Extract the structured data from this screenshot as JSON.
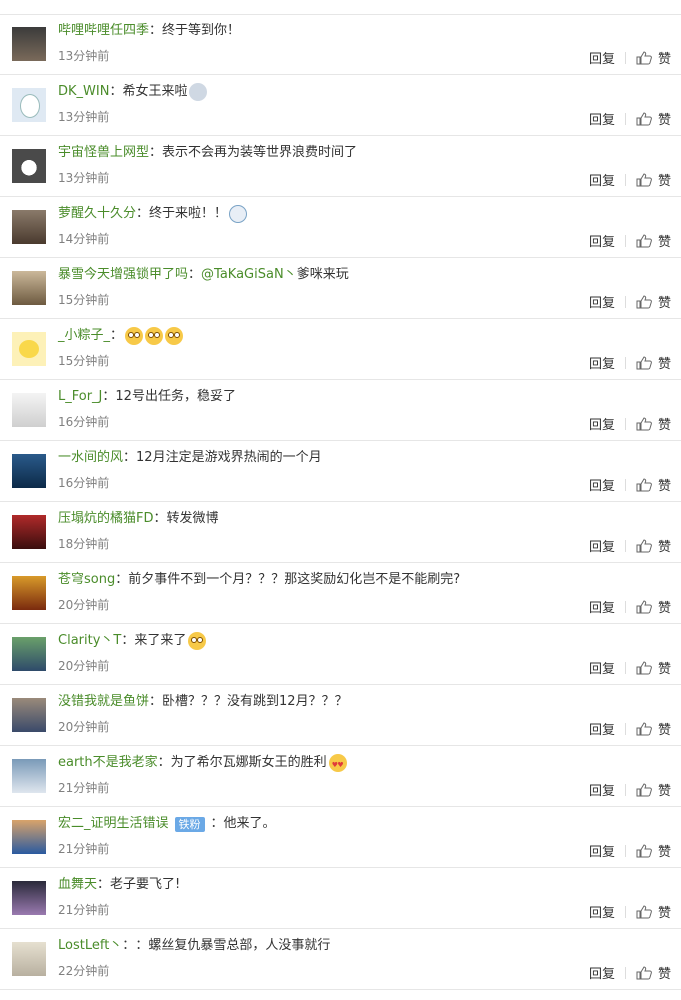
{
  "actions": {
    "reply": "回复",
    "like": "赞"
  },
  "comments": [
    {
      "user": "哔哩哔哩任四季",
      "text": "终于等到你！",
      "time": "13分钟前"
    },
    {
      "user": "DK_WIN",
      "text": "希女王来啦",
      "time": "13分钟前"
    },
    {
      "user": "宇宙怪兽上网型",
      "text": "表示不会再为装等世界浪费时间了",
      "time": "13分钟前"
    },
    {
      "user": "萝醒久十久分",
      "text": "终于来啦！！",
      "time": "14分钟前"
    },
    {
      "user": "暴雪今天增强锁甲了吗",
      "text_mention": "@TaKaGiSaN丶",
      "text": " 爹咪来玩",
      "time": "15分钟前"
    },
    {
      "user": "_小粽子_",
      "text": "",
      "time": "15分钟前"
    },
    {
      "user": "L_For_J",
      "text": "12号出任务，稳妥了",
      "time": "16分钟前"
    },
    {
      "user": "一水间的风",
      "text": "12月注定是游戏界热闹的一个月",
      "time": "16分钟前"
    },
    {
      "user": "压塌炕的橘猫FD",
      "text": "转发微博",
      "time": "18分钟前"
    },
    {
      "user": "苍穹song",
      "text": "前夕事件不到一个月？？？那这奖励幻化岂不是不能刷完?",
      "time": "20分钟前"
    },
    {
      "user": "Clarity丶T",
      "text": "来了来了",
      "time": "20分钟前"
    },
    {
      "user": "没错我就是鱼饼",
      "text": "卧槽？？？没有跳到12月？？？",
      "time": "20分钟前"
    },
    {
      "user": "earth不是我老家",
      "text": "为了希尔瓦娜斯女王的胜利",
      "time": "21分钟前"
    },
    {
      "user": "宏二_证明生活错误",
      "badge": "铁粉",
      "text": "他来了。",
      "time": "21分钟前"
    },
    {
      "user": "血舞天",
      "text": "老子要飞了!",
      "time": "21分钟前"
    },
    {
      "user": "LostLeft丶",
      "text": "：螺丝复仇暴雪总部，人没事就行",
      "time": "22分钟前"
    }
  ]
}
